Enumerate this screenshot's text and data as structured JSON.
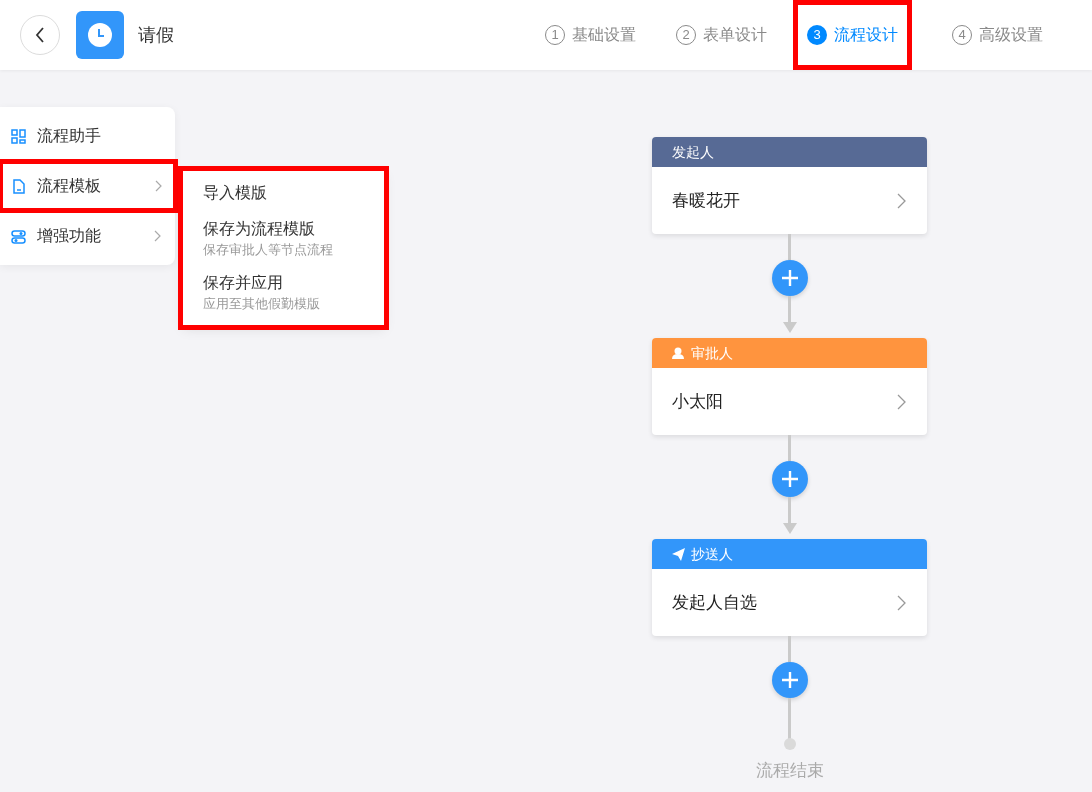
{
  "header": {
    "title": "请假"
  },
  "steps": [
    {
      "number": "1",
      "label": "基础设置",
      "selected": false,
      "highlighted": false
    },
    {
      "number": "2",
      "label": "表单设计",
      "selected": false,
      "highlighted": false
    },
    {
      "number": "3",
      "label": "流程设计",
      "selected": true,
      "highlighted": true
    },
    {
      "number": "4",
      "label": "高级设置",
      "selected": false,
      "highlighted": false
    }
  ],
  "side_menu": {
    "items": [
      {
        "kind": "assistant",
        "label": "流程助手",
        "has_submenu": false,
        "highlighted": false
      },
      {
        "kind": "template",
        "label": "流程模板",
        "has_submenu": true,
        "highlighted": true
      },
      {
        "kind": "enhance",
        "label": "增强功能",
        "has_submenu": true,
        "highlighted": false
      }
    ]
  },
  "submenu": {
    "highlighted": true,
    "items": [
      {
        "label": "导入模版"
      },
      {
        "label": "保存为流程模版",
        "description": "保存审批人等节点流程"
      },
      {
        "label": "保存并应用",
        "description": "应用至其他假勤模版"
      }
    ]
  },
  "flow": {
    "nodes": [
      {
        "kind": "initiator",
        "title": "发起人",
        "value": "春暖花开",
        "color": "#576a95"
      },
      {
        "kind": "approver",
        "title": "审批人",
        "value": "小太阳",
        "color": "#ff943e"
      },
      {
        "kind": "cc",
        "title": "抄送人",
        "value": "发起人自选",
        "color": "#3296fa"
      }
    ],
    "end_label": "流程结束"
  }
}
